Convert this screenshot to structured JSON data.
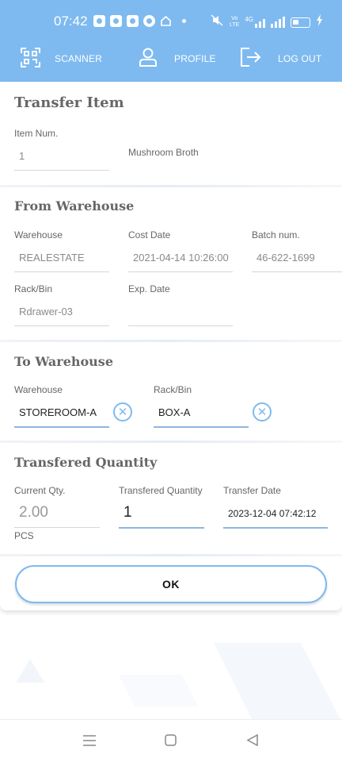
{
  "status_bar": {
    "time": "07:42",
    "network_small_top": "Vo",
    "network_small_bottom": "LTE",
    "network_type": "4G"
  },
  "nav": {
    "scanner_label": "SCANNER",
    "profile_label": "PROFILE",
    "logout_label": "LOG OUT"
  },
  "item": {
    "title": "Transfer Item",
    "item_num_label": "Item Num.",
    "item_num_value": "1",
    "item_name": "Mushroom Broth"
  },
  "from": {
    "title": "From Warehouse",
    "warehouse_label": "Warehouse",
    "warehouse_value": "REALESTATE",
    "cost_date_label": "Cost Date",
    "cost_date_value": "2021-04-14 10:26:00",
    "batch_label": "Batch num.",
    "batch_value": "46-622-1699",
    "rack_label": "Rack/Bin",
    "rack_value": "Rdrawer-03",
    "exp_label": "Exp. Date",
    "exp_value": ""
  },
  "to": {
    "title": "To Warehouse",
    "warehouse_label": "Warehouse",
    "warehouse_value": "STOREROOM-A",
    "rack_label": "Rack/Bin",
    "rack_value": "BOX-A",
    "clear_glyph": "✕"
  },
  "quantity": {
    "title": "Transfered Quantity",
    "current_label": "Current Qty.",
    "current_value": "2.00",
    "unit": "PCS",
    "transfered_label": "Transfered Quantity",
    "transfered_value": "1",
    "date_label": "Transfer Date",
    "date_value": "2023-12-04 07:42:12"
  },
  "ok_label": "OK",
  "colors": {
    "accent": "#7ebaf0",
    "underline_active": "#8cb6de"
  }
}
